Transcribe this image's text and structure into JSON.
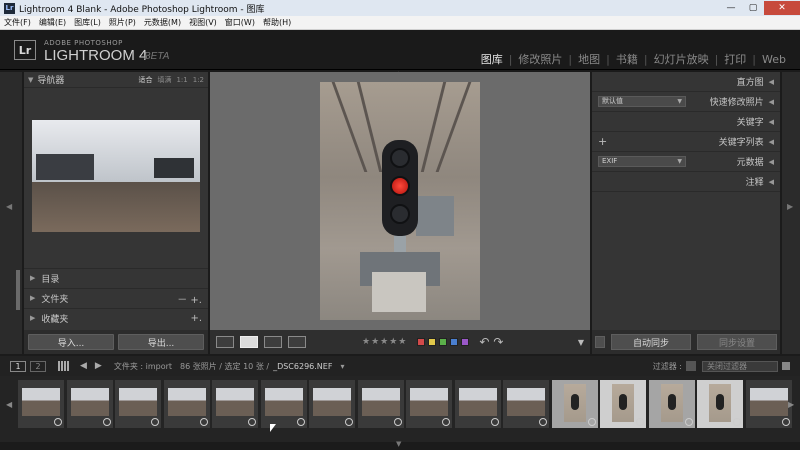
{
  "window": {
    "title": "Lightroom 4 Blank - Adobe Photoshop Lightroom - 图库",
    "min_icon": "minimize-icon",
    "max_icon": "maximize-icon",
    "close_icon": "close-icon"
  },
  "menu": [
    "文件(F)",
    "编辑(E)",
    "图库(L)",
    "照片(P)",
    "元数据(M)",
    "视图(V)",
    "窗口(W)",
    "帮助(H)"
  ],
  "identity": {
    "logo": "Lr",
    "brand_top": "ADOBE PHOTOSHOP",
    "brand_main": "LIGHTROOM 4",
    "brand_beta": "BETA"
  },
  "modules": [
    "图库",
    "修改照片",
    "地图",
    "书籍",
    "幻灯片放映",
    "打印",
    "Web"
  ],
  "active_module": "图库",
  "left_panel": {
    "navigator": {
      "title": "导航器",
      "options": [
        "适合",
        "填满",
        "1:1",
        "1:2"
      ]
    },
    "sections": [
      {
        "name": "目录",
        "ctl": ""
      },
      {
        "name": "文件夹",
        "ctl": "－ +."
      },
      {
        "name": "收藏夹",
        "ctl": "+."
      }
    ],
    "import_label": "导入...",
    "export_label": "导出..."
  },
  "right_panel": {
    "rows": [
      {
        "name": "直方图"
      },
      {
        "name": "快速修改照片",
        "dropdown": "默认值"
      },
      {
        "name": "关键字"
      },
      {
        "name": "关键字列表",
        "plus": "+"
      },
      {
        "name": "元数据",
        "dropdown": "EXIF"
      },
      {
        "name": "注释"
      }
    ],
    "sync_auto_label": "自动同步",
    "sync_settings_label": "同步设置"
  },
  "toolbar": {
    "stars": "★★★★★",
    "color_labels": [
      "#d24a4a",
      "#e0c84a",
      "#5bb04a",
      "#4a7fd0",
      "#9a58c8"
    ]
  },
  "filmstrip": {
    "num1": "1",
    "num2": "2",
    "source": "文件夹 : import",
    "count": "86 张照片 / 选定 10 张 /",
    "filename": "_DSC6296.NEF",
    "filter_label": "过滤器 :",
    "filter_value": "关闭过滤器",
    "thumb_count": 16
  }
}
